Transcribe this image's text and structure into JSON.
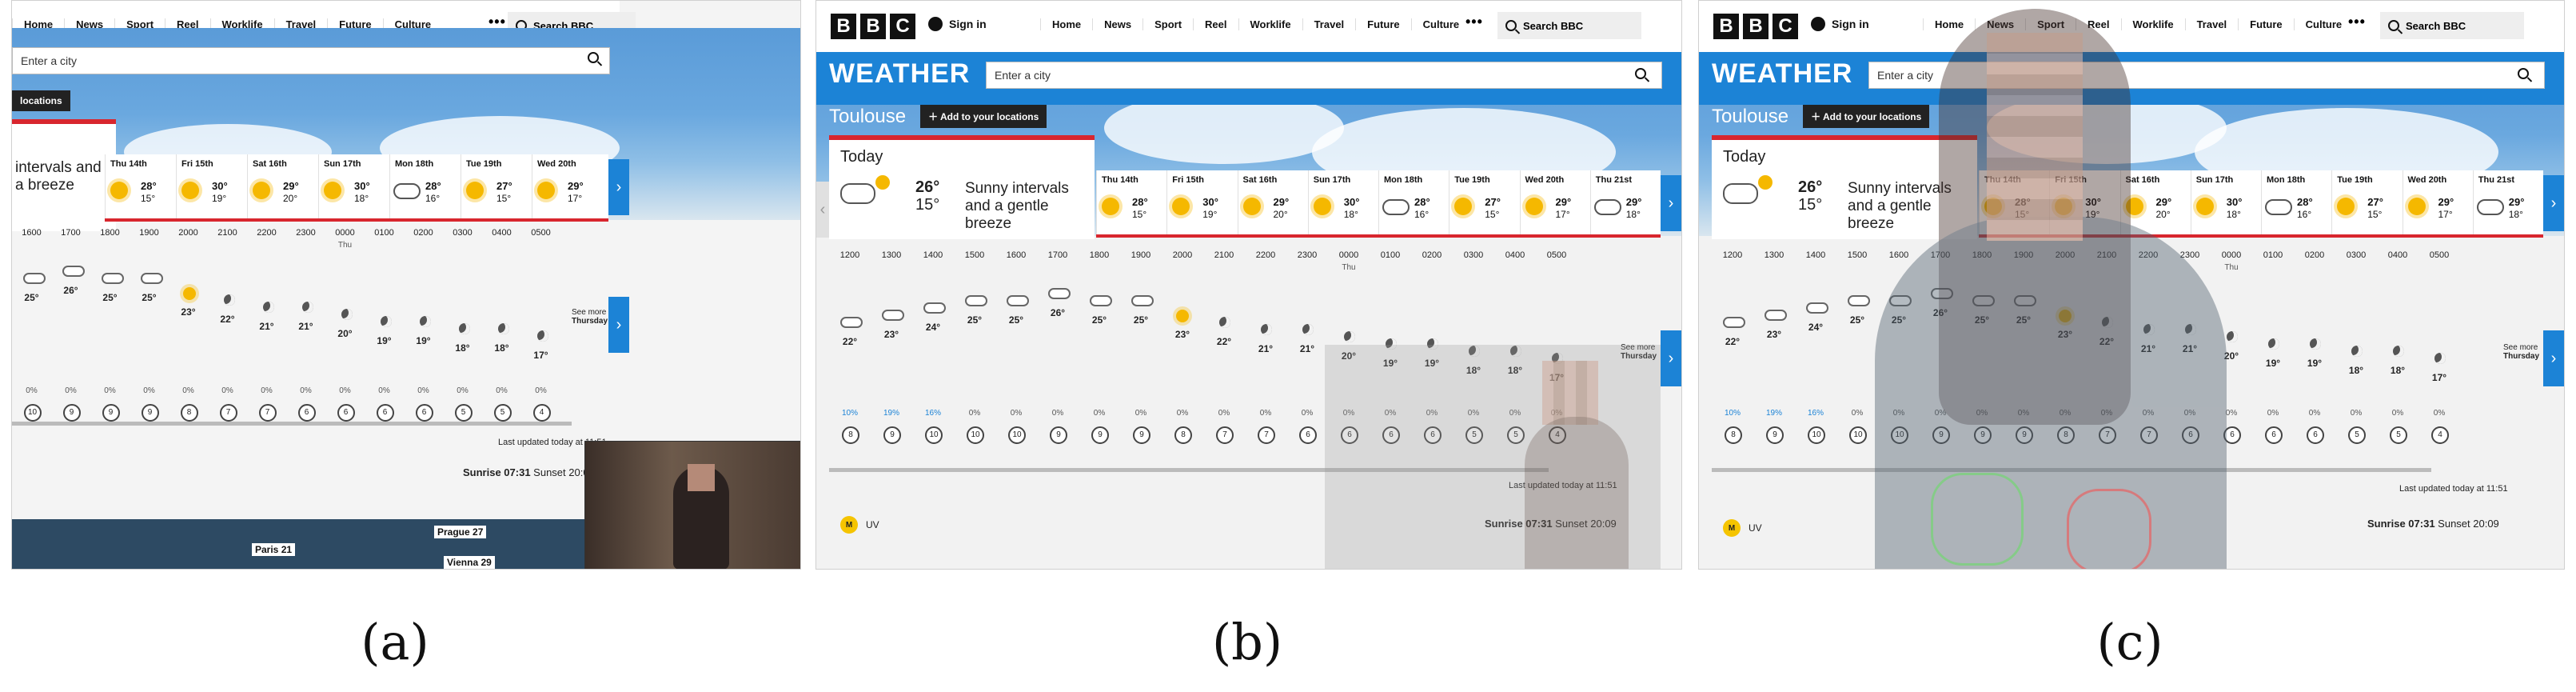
{
  "nav": {
    "bbc_letters": [
      "B",
      "B",
      "C"
    ],
    "sign_in": "Sign in",
    "links": [
      "Home",
      "News",
      "Sport",
      "Reel",
      "Worklife",
      "Travel",
      "Future",
      "Culture"
    ],
    "more": "•••",
    "search": "Search BBC"
  },
  "weather": {
    "title": "WEATHER",
    "city_placeholder": "Enter a city",
    "location": "Toulouse",
    "add_location": "Add to your locations",
    "partial_location_tab": "locations",
    "today_label": "Today",
    "today_high": "26°",
    "today_low": "15°",
    "today_desc": "Sunny intervals and a gentle breeze",
    "today_desc_partial": "intervals and a breeze",
    "days": [
      {
        "name": "Thu 14th",
        "hi": "28°",
        "lo": "15°",
        "icon": "sun"
      },
      {
        "name": "Fri 15th",
        "hi": "30°",
        "lo": "19°",
        "icon": "sun"
      },
      {
        "name": "Sat 16th",
        "hi": "29°",
        "lo": "20°",
        "icon": "sun"
      },
      {
        "name": "Sun 17th",
        "hi": "30°",
        "lo": "18°",
        "icon": "sun"
      },
      {
        "name": "Mon 18th",
        "hi": "28°",
        "lo": "16°",
        "icon": "cloud"
      },
      {
        "name": "Tue 19th",
        "hi": "27°",
        "lo": "15°",
        "icon": "sun"
      },
      {
        "name": "Wed 20th",
        "hi": "29°",
        "lo": "17°",
        "icon": "sun"
      },
      {
        "name": "Thu 21st",
        "hi": "29°",
        "lo": "18°",
        "icon": "storm"
      }
    ],
    "hours": [
      {
        "t": "1200",
        "temp": "22°",
        "icon": "pcloud",
        "rain": "10%",
        "blue": true,
        "wind": "8"
      },
      {
        "t": "1300",
        "temp": "23°",
        "icon": "pcloud",
        "rain": "19%",
        "blue": true,
        "wind": "9"
      },
      {
        "t": "1400",
        "temp": "24°",
        "icon": "pcloud",
        "rain": "16%",
        "blue": true,
        "wind": "10"
      },
      {
        "t": "1500",
        "temp": "25°",
        "icon": "pcloud",
        "rain": "0%",
        "blue": false,
        "wind": "10"
      },
      {
        "t": "1600",
        "temp": "25°",
        "icon": "pcloud",
        "rain": "0%",
        "blue": false,
        "wind": "10"
      },
      {
        "t": "1700",
        "temp": "26°",
        "icon": "pcloud",
        "rain": "0%",
        "blue": false,
        "wind": "9"
      },
      {
        "t": "1800",
        "temp": "25°",
        "icon": "pcloud",
        "rain": "0%",
        "blue": false,
        "wind": "9"
      },
      {
        "t": "1900",
        "temp": "25°",
        "icon": "pcloud",
        "rain": "0%",
        "blue": false,
        "wind": "9"
      },
      {
        "t": "2000",
        "temp": "23°",
        "icon": "sunny",
        "rain": "0%",
        "blue": false,
        "wind": "8"
      },
      {
        "t": "2100",
        "temp": "22°",
        "icon": "moon",
        "rain": "0%",
        "blue": false,
        "wind": "7"
      },
      {
        "t": "2200",
        "temp": "21°",
        "icon": "moon",
        "rain": "0%",
        "blue": false,
        "wind": "7"
      },
      {
        "t": "2300",
        "temp": "21°",
        "icon": "moon",
        "rain": "0%",
        "blue": false,
        "wind": "6"
      },
      {
        "t": "0000",
        "th": "Thu",
        "temp": "20°",
        "icon": "moon",
        "rain": "0%",
        "blue": false,
        "wind": "6"
      },
      {
        "t": "0100",
        "temp": "19°",
        "icon": "moon",
        "rain": "0%",
        "blue": false,
        "wind": "6"
      },
      {
        "t": "0200",
        "temp": "19°",
        "icon": "moon",
        "rain": "0%",
        "blue": false,
        "wind": "6"
      },
      {
        "t": "0300",
        "temp": "18°",
        "icon": "moon",
        "rain": "0%",
        "blue": false,
        "wind": "5"
      },
      {
        "t": "0400",
        "temp": "18°",
        "icon": "moon",
        "rain": "0%",
        "blue": false,
        "wind": "5"
      },
      {
        "t": "0500",
        "temp": "17°",
        "icon": "moon",
        "rain": "0%",
        "blue": false,
        "wind": "4"
      }
    ],
    "partial_hours": [
      {
        "t": "1600",
        "temp": "25°",
        "icon": "pcloud",
        "rain": "0%",
        "wind": "10"
      },
      {
        "t": "1700",
        "temp": "26°",
        "icon": "pcloud",
        "rain": "0%",
        "wind": "9"
      },
      {
        "t": "1800",
        "temp": "25°",
        "icon": "pcloud",
        "rain": "0%",
        "wind": "9"
      },
      {
        "t": "1900",
        "temp": "25°",
        "icon": "pcloud",
        "rain": "0%",
        "wind": "9"
      },
      {
        "t": "2000",
        "temp": "23°",
        "icon": "sunny",
        "rain": "0%",
        "wind": "8"
      },
      {
        "t": "2100",
        "temp": "22°",
        "icon": "moon",
        "rain": "0%",
        "wind": "7"
      },
      {
        "t": "2200",
        "temp": "21°",
        "icon": "moon",
        "rain": "0%",
        "wind": "7"
      },
      {
        "t": "2300",
        "temp": "21°",
        "icon": "moon",
        "rain": "0%",
        "wind": "6"
      },
      {
        "t": "0000",
        "th": "Thu",
        "temp": "20°",
        "icon": "moon",
        "rain": "0%",
        "wind": "6"
      },
      {
        "t": "0100",
        "temp": "19°",
        "icon": "moon",
        "rain": "0%",
        "wind": "6"
      },
      {
        "t": "0200",
        "temp": "19°",
        "icon": "moon",
        "rain": "0%",
        "wind": "6"
      },
      {
        "t": "0300",
        "temp": "18°",
        "icon": "moon",
        "rain": "0%",
        "wind": "5"
      },
      {
        "t": "0400",
        "temp": "18°",
        "icon": "moon",
        "rain": "0%",
        "wind": "5"
      },
      {
        "t": "0500",
        "temp": "17°",
        "icon": "moon",
        "rain": "0%",
        "wind": "4"
      }
    ],
    "see_more": "See more",
    "see_more_day": "Thursday",
    "last_updated": "Last updated today at 11:51",
    "sunrise": "Sunrise 07:31",
    "sunset": "Sunset 20:09",
    "uv_badge": "M",
    "uv_label": "UV"
  },
  "map": {
    "labels": [
      {
        "city": "Prague",
        "temp": "27"
      },
      {
        "city": "Paris",
        "temp": "21"
      },
      {
        "city": "Vienna",
        "temp": "29"
      }
    ]
  },
  "captions": [
    "(a)",
    "(b)",
    "(c)"
  ],
  "colors": {
    "accent_blue": "#1c83d6",
    "today_red": "#d8262e",
    "sun": "#f5b800"
  }
}
